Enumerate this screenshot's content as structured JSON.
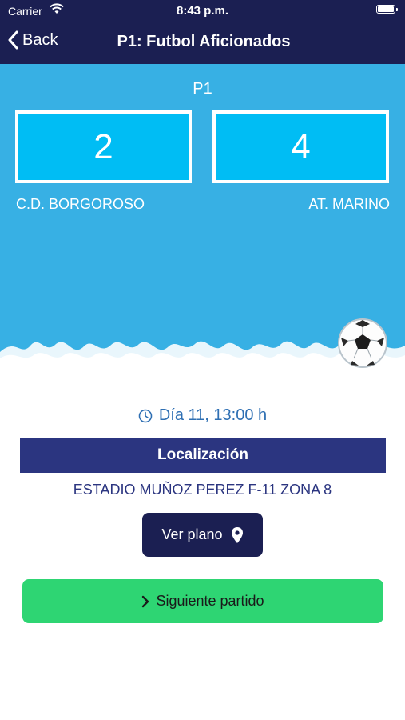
{
  "status_bar": {
    "carrier": "Carrier",
    "time": "8:43 p.m."
  },
  "nav": {
    "back_label": "Back",
    "title": "P1: Futbol Aficionados"
  },
  "match": {
    "period": "P1",
    "home_score": "2",
    "away_score": "4",
    "home_team": "C.D. BORGOROSO",
    "away_team": "AT. MARINO"
  },
  "schedule": {
    "datetime": "Día 11, 13:00 h"
  },
  "location": {
    "header": "Localización",
    "venue": "ESTADIO MUÑOZ PEREZ F-11 ZONA 8",
    "map_button_label": "Ver plano"
  },
  "next_button_label": "Siguiente partido",
  "icons": [
    "wifi-icon",
    "battery-icon",
    "back-chevron-icon",
    "clock-icon",
    "map-pin-icon",
    "chevron-right-icon",
    "soccer-ball-icon"
  ],
  "colors": {
    "header_navy": "#1b1f52",
    "sky_blue": "#37b0e4",
    "score_box": "#00bdf4",
    "location_bar": "#2b3580",
    "date_text": "#2e6fb3",
    "next_button": "#2ed573"
  }
}
